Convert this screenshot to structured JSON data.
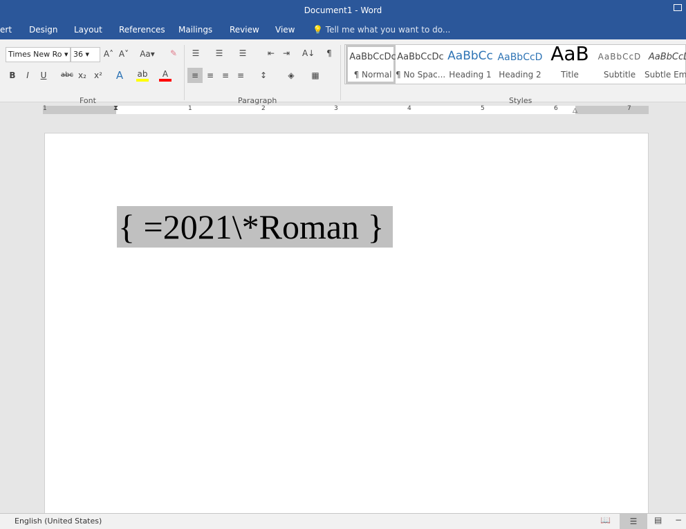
{
  "window": {
    "title": "Document1 - Word"
  },
  "tabs": [
    "ert",
    "Design",
    "Layout",
    "References",
    "Mailings",
    "Review",
    "View"
  ],
  "tell_me": "Tell me what you want to do...",
  "font": {
    "name": "Times New Ro",
    "size": "36",
    "group_label": "Font"
  },
  "paragraph": {
    "group_label": "Paragraph"
  },
  "styles": {
    "group_label": "Styles",
    "items": [
      {
        "preview": "AaBbCcDc",
        "name": "¶ Normal",
        "selected": true
      },
      {
        "preview": "AaBbCcDc",
        "name": "¶ No Spac..."
      },
      {
        "preview": "AaBbCc",
        "name": "Heading 1",
        "color": "#2e74b5"
      },
      {
        "preview": "AaBbCcD",
        "name": "Heading 2",
        "color": "#2e74b5"
      },
      {
        "preview": "AaB",
        "name": "Title"
      },
      {
        "preview": "AaBbCcD",
        "name": "Subtitle"
      },
      {
        "preview": "AaBbCcD",
        "name": "Subtle Em..."
      }
    ]
  },
  "ruler": {
    "numbers": [
      "1",
      "1",
      "2",
      "3",
      "4",
      "5",
      "6",
      "7"
    ]
  },
  "document": {
    "field_code": "{ =2021\\*Roman }"
  },
  "status": {
    "language": "English (United States)"
  },
  "colors": {
    "brand": "#2b579a",
    "highlight": "#ffff00",
    "font_color": "#ff0000"
  }
}
